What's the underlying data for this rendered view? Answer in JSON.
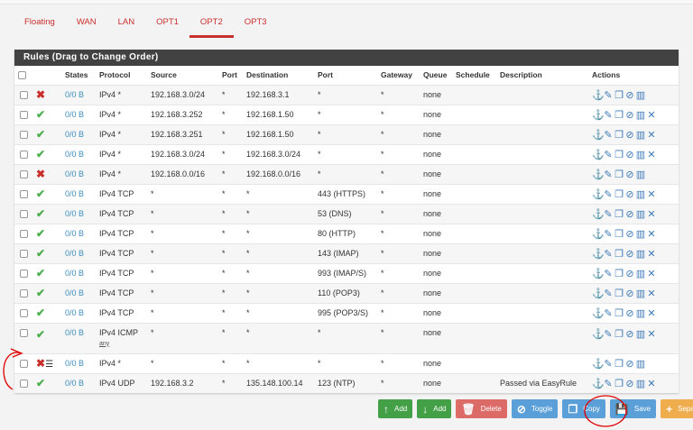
{
  "tabs": [
    {
      "label": "Floating"
    },
    {
      "label": "WAN"
    },
    {
      "label": "LAN"
    },
    {
      "label": "OPT1"
    },
    {
      "label": "OPT2",
      "active": true
    },
    {
      "label": "OPT3"
    }
  ],
  "panel_title": "Rules (Drag to Change Order)",
  "columns": [
    "",
    "",
    "States",
    "Protocol",
    "Source",
    "Port",
    "Destination",
    "Port",
    "Gateway",
    "Queue",
    "Schedule",
    "Description",
    "Actions"
  ],
  "rows": [
    {
      "action": "block",
      "states": "0/0 B",
      "protocol": "IPv4 *",
      "source": "192.168.3.0/24",
      "sport": "*",
      "dest": "192.168.3.1",
      "dport": "*",
      "gateway": "*",
      "queue": "none",
      "schedule": "",
      "description": "",
      "x": false
    },
    {
      "action": "pass",
      "states": "0/0 B",
      "protocol": "IPv4 *",
      "source": "192.168.3.252",
      "sport": "*",
      "dest": "192.168.1.50",
      "dport": "*",
      "gateway": "*",
      "queue": "none",
      "schedule": "",
      "description": "",
      "x": true
    },
    {
      "action": "pass",
      "states": "0/0 B",
      "protocol": "IPv4 *",
      "source": "192.168.3.251",
      "sport": "*",
      "dest": "192.168.1.50",
      "dport": "*",
      "gateway": "*",
      "queue": "none",
      "schedule": "",
      "description": "",
      "x": true
    },
    {
      "action": "pass",
      "states": "0/0 B",
      "protocol": "IPv4 *",
      "source": "192.168.3.0/24",
      "sport": "*",
      "dest": "192.168.3.0/24",
      "dport": "*",
      "gateway": "*",
      "queue": "none",
      "schedule": "",
      "description": "",
      "x": true
    },
    {
      "action": "block",
      "states": "0/0 B",
      "protocol": "IPv4 *",
      "source": "192.168.0.0/16",
      "sport": "*",
      "dest": "192.168.0.0/16",
      "dport": "*",
      "gateway": "*",
      "queue": "none",
      "schedule": "",
      "description": "",
      "x": false
    },
    {
      "action": "pass",
      "states": "0/0 B",
      "protocol": "IPv4 TCP",
      "source": "*",
      "sport": "*",
      "dest": "*",
      "dport": "443 (HTTPS)",
      "gateway": "*",
      "queue": "none",
      "schedule": "",
      "description": "",
      "x": true
    },
    {
      "action": "pass",
      "states": "0/0 B",
      "protocol": "IPv4 TCP",
      "source": "*",
      "sport": "*",
      "dest": "*",
      "dport": "53 (DNS)",
      "gateway": "*",
      "queue": "none",
      "schedule": "",
      "description": "",
      "x": true
    },
    {
      "action": "pass",
      "states": "0/0 B",
      "protocol": "IPv4 TCP",
      "source": "*",
      "sport": "*",
      "dest": "*",
      "dport": "80 (HTTP)",
      "gateway": "*",
      "queue": "none",
      "schedule": "",
      "description": "",
      "x": true
    },
    {
      "action": "pass",
      "states": "0/0 B",
      "protocol": "IPv4 TCP",
      "source": "*",
      "sport": "*",
      "dest": "*",
      "dport": "143 (IMAP)",
      "gateway": "*",
      "queue": "none",
      "schedule": "",
      "description": "",
      "x": true
    },
    {
      "action": "pass",
      "states": "0/0 B",
      "protocol": "IPv4 TCP",
      "source": "*",
      "sport": "*",
      "dest": "*",
      "dport": "993 (IMAP/S)",
      "gateway": "*",
      "queue": "none",
      "schedule": "",
      "description": "",
      "x": true
    },
    {
      "action": "pass",
      "states": "0/0 B",
      "protocol": "IPv4 TCP",
      "source": "*",
      "sport": "*",
      "dest": "*",
      "dport": "110 (POP3)",
      "gateway": "*",
      "queue": "none",
      "schedule": "",
      "description": "",
      "x": true
    },
    {
      "action": "pass",
      "states": "0/0 B",
      "protocol": "IPv4 TCP",
      "source": "*",
      "sport": "*",
      "dest": "*",
      "dport": "995 (POP3/S)",
      "gateway": "*",
      "queue": "none",
      "schedule": "",
      "description": "",
      "x": true
    },
    {
      "action": "pass",
      "states": "0/0 B",
      "protocol": "IPv4 ICMP",
      "subproto": "any",
      "source": "*",
      "sport": "*",
      "dest": "*",
      "dport": "*",
      "gateway": "*",
      "queue": "none",
      "schedule": "",
      "description": "",
      "x": true
    },
    {
      "action": "block",
      "log": true,
      "states": "0/0 B",
      "protocol": "IPv4 *",
      "source": "*",
      "sport": "*",
      "dest": "*",
      "dport": "*",
      "gateway": "*",
      "queue": "none",
      "schedule": "",
      "description": "",
      "x": false
    },
    {
      "action": "pass",
      "states": "0/0 B",
      "protocol": "IPv4 UDP",
      "source": "192.168.3.2",
      "sport": "*",
      "dest": "135.148.100.14",
      "dport": "123 (NTP)",
      "gateway": "*",
      "queue": "none",
      "schedule": "",
      "description": "Passed via EasyRule",
      "x": true
    }
  ],
  "buttons": {
    "add_top": "Add",
    "add_bottom": "Add",
    "delete": "Delete",
    "toggle": "Toggle",
    "copy": "Copy",
    "save": "Save",
    "separator": "Separator"
  },
  "colors": {
    "tab_accent": "#c9302c",
    "pass": "#4cae4c",
    "block": "#c9302c",
    "action_icons": "#3d7ab8",
    "annotation": "#e00000"
  }
}
